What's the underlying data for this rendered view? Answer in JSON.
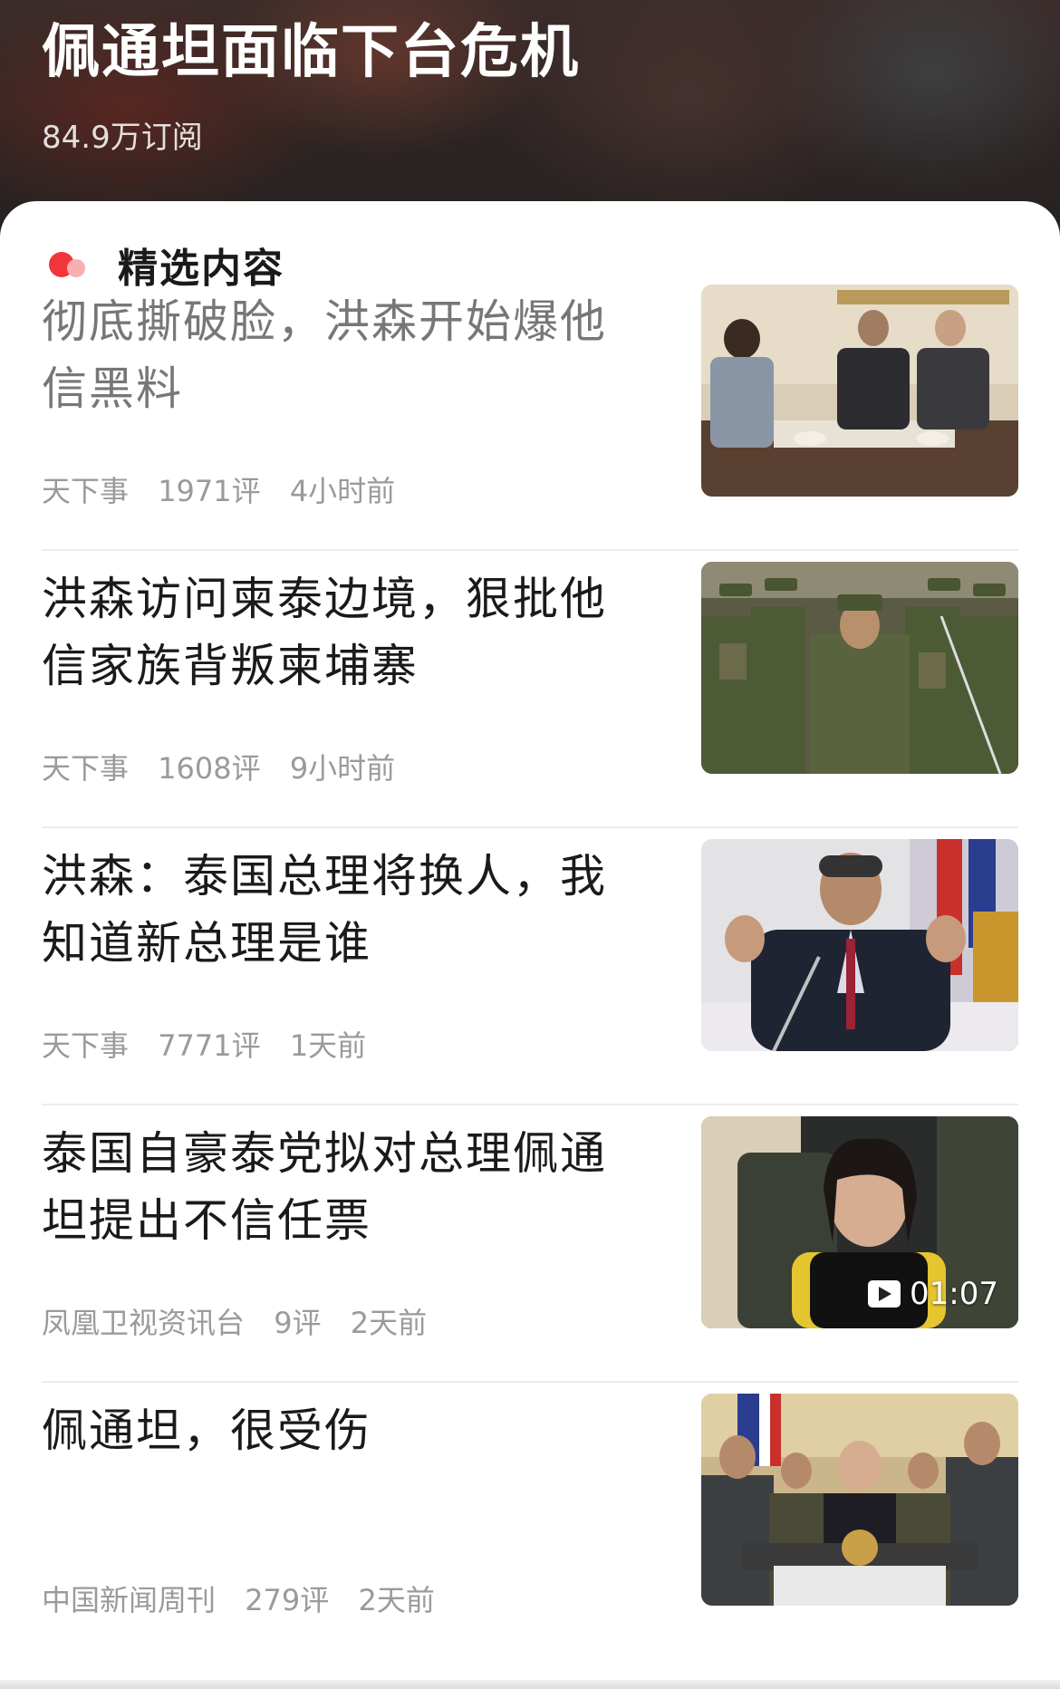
{
  "header": {
    "title": "佩通坦面临下台危机",
    "subscribers": "84.9万订阅"
  },
  "section": {
    "title": "精选内容"
  },
  "news": [
    {
      "title": "彻底撕破脸，洪森开始爆他信黑料",
      "source": "天下事",
      "comments": "1971评",
      "time": "4小时前",
      "read": true
    },
    {
      "title": "洪森访问柬泰边境，狠批他信家族背叛柬埔寨",
      "source": "天下事",
      "comments": "1608评",
      "time": "9小时前",
      "read": false
    },
    {
      "title": "洪森：泰国总理将换人，我知道新总理是谁",
      "source": "天下事",
      "comments": "7771评",
      "time": "1天前",
      "read": false
    },
    {
      "title": "泰国自豪泰党拟对总理佩通坦提出不信任票",
      "source": "凤凰卫视资讯台",
      "comments": "9评",
      "time": "2天前",
      "read": false,
      "video_duration": "01:07"
    },
    {
      "title": "佩通坦，很受伤",
      "source": "中国新闻周刊",
      "comments": "279评",
      "time": "2天前",
      "read": false
    }
  ],
  "colors": {
    "accent_red": "#f0363a",
    "accent_pink": "#f9aeb0",
    "meta_gray": "#9a9a9a"
  }
}
